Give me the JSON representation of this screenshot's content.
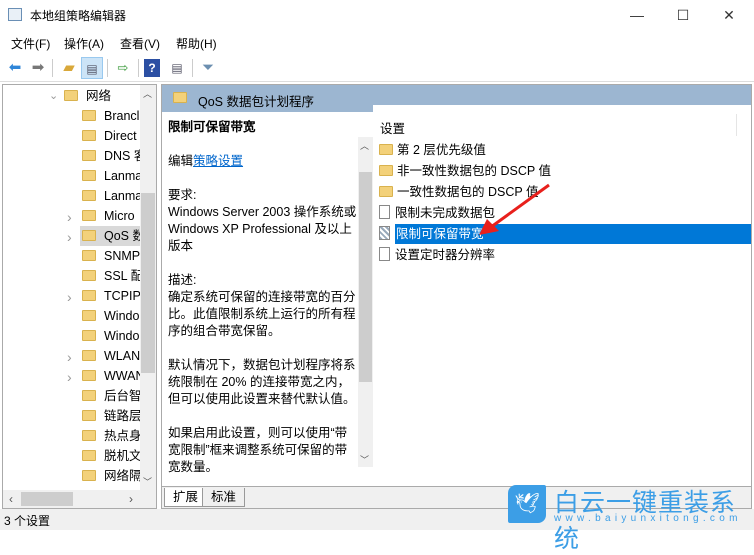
{
  "window": {
    "title": "本地组策略编辑器",
    "minimize": "—",
    "maximize": "☐",
    "close": "✕"
  },
  "menu": [
    "文件(F)",
    "操作(A)",
    "查看(V)",
    "帮助(H)"
  ],
  "toolbar": [
    "back-icon",
    "forward-icon",
    "up-folder-icon",
    "show-hide-tree-icon",
    "export-list-icon",
    "help-icon",
    "show-action-pane-icon",
    "filter-icon"
  ],
  "tree": {
    "root": "网络",
    "items": [
      {
        "label": "Brancl",
        "expandable": false
      },
      {
        "label": "Direct",
        "expandable": false
      },
      {
        "label": "DNS 客",
        "expandable": false
      },
      {
        "label": "Lanma",
        "expandable": false
      },
      {
        "label": "Lanma",
        "expandable": false
      },
      {
        "label": "Micro",
        "expandable": true
      },
      {
        "label": "QoS 数",
        "expandable": true,
        "selected": true
      },
      {
        "label": "SNMP",
        "expandable": false
      },
      {
        "label": "SSL 配",
        "expandable": false
      },
      {
        "label": "TCPIP",
        "expandable": true
      },
      {
        "label": "Windo",
        "expandable": false
      },
      {
        "label": "Windo",
        "expandable": false
      },
      {
        "label": "WLAN",
        "expandable": true
      },
      {
        "label": "WWAN",
        "expandable": true
      },
      {
        "label": "后台智",
        "expandable": false
      },
      {
        "label": "链路层",
        "expandable": false
      },
      {
        "label": "热点身",
        "expandable": false
      },
      {
        "label": "脱机文",
        "expandable": false
      },
      {
        "label": "网络隔",
        "expandable": false
      }
    ]
  },
  "pane_header": "QoS 数据包计划程序",
  "description": {
    "title": "限制可保留带宽",
    "edit_prefix": "编辑",
    "edit_link": "策略设置",
    "req_label": "要求:",
    "req_text": "Windows Server 2003 操作系统或 Windows XP Professional 及以上版本",
    "desc_label": "描述:",
    "desc_text": "确定系统可保留的连接带宽的百分比。此值限制系统上运行的所有程序的组合带宽保留。",
    "default_text": "默认情况下，数据包计划程序将系统限制在 20% 的连接带宽之内，但可以使用此设置来替代默认值。",
    "enable_text": "如果启用此设置，则可以使用“带宽限制”框来调整系统可保留的带宽数量。"
  },
  "list": {
    "header": "设置",
    "rows": [
      {
        "label": "第 2 层优先级值",
        "type": "folder"
      },
      {
        "label": "非一致性数据包的 DSCP 值",
        "type": "folder"
      },
      {
        "label": "一致性数据包的 DSCP 值",
        "type": "folder"
      },
      {
        "label": "限制未完成数据包",
        "type": "policy"
      },
      {
        "label": "限制可保留带宽",
        "type": "policy",
        "selected": true
      },
      {
        "label": "设置定时器分辨率",
        "type": "policy"
      }
    ]
  },
  "tabs": [
    "扩展",
    "标准"
  ],
  "active_tab": "扩展",
  "status": "3 个设置",
  "watermark": {
    "name": "白云一键重装系统",
    "url": "www.baiyunxitong.com"
  },
  "colors": {
    "selection": "#0078d7",
    "header": "#9cb6d1",
    "arrow": "#e8201c",
    "watermark": "#3c9ee6"
  }
}
